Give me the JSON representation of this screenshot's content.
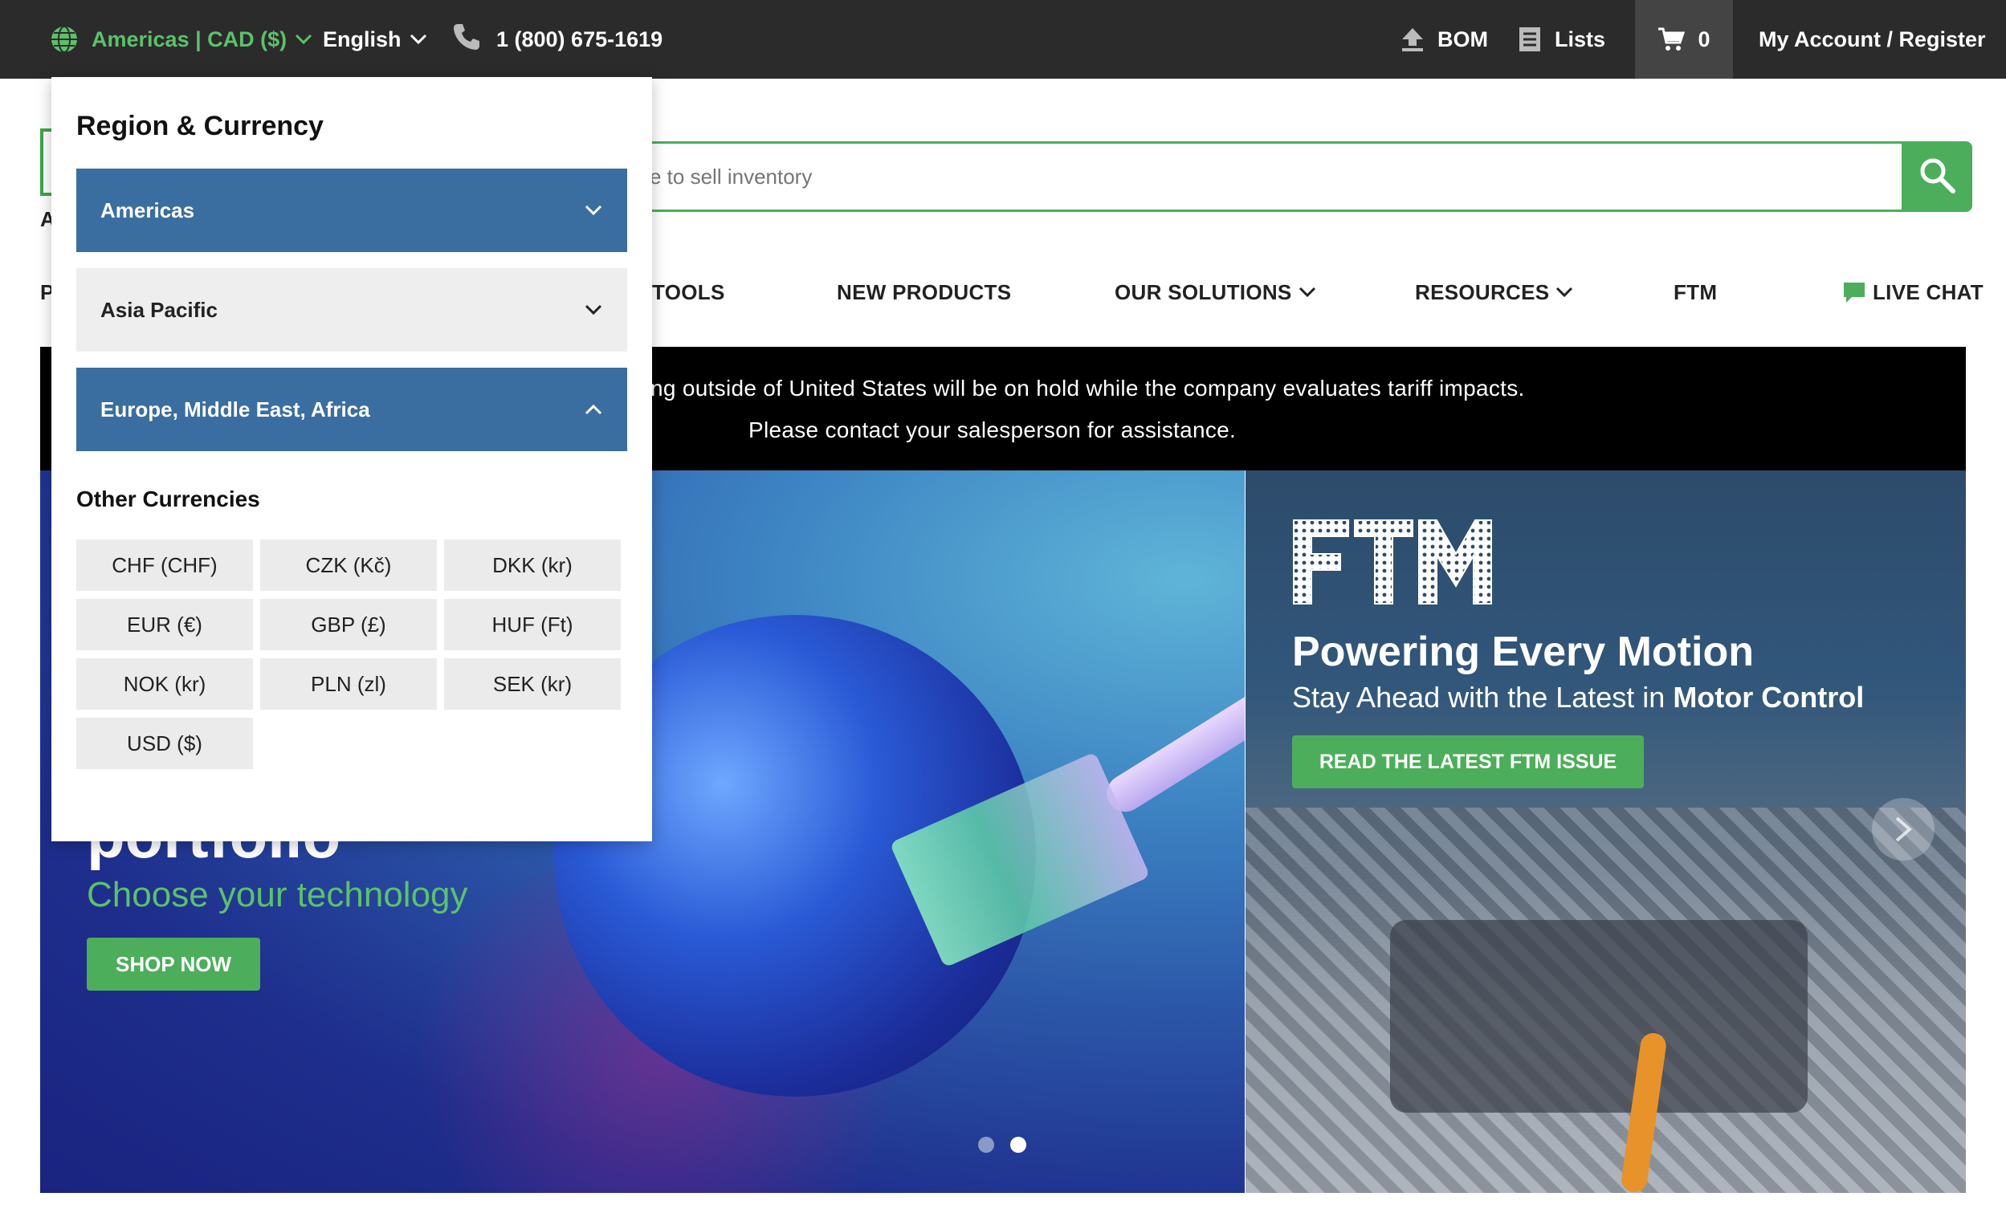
{
  "topbar": {
    "region_label": "Americas | CAD ($)",
    "language_label": "English",
    "phone_label": "1 (800) 675-1619",
    "bom_label": "BOM",
    "lists_label": "Lists",
    "cart_count": "0",
    "account_label": "My Account / Register"
  },
  "search": {
    "placeholder": "e to sell inventory"
  },
  "nav": {
    "partial_left": "P",
    "tools": "TOOLS",
    "new_products": "NEW PRODUCTS",
    "our_solutions": "OUR SOLUTIONS",
    "resources": "RESOURCES",
    "ftm": "FTM",
    "live_chat": "LIVE CHAT"
  },
  "logo_fragment_letter": "A",
  "notice": {
    "line1": "ng outside of United States will be on hold while the company evaluates tariff impacts.",
    "line2": "Please contact your salesperson for assistance."
  },
  "banner_left": {
    "title": "portfolio",
    "subtitle": "Choose your technology",
    "button": "SHOP NOW"
  },
  "banner_right": {
    "logo_text": "FTM",
    "title": "Powering Every Motion",
    "subtitle_prefix": "Stay Ahead with the Latest in ",
    "subtitle_bold": "Motor Control",
    "button": "READ THE LATEST FTM ISSUE"
  },
  "dropdown": {
    "title": "Region & Currency",
    "regions": [
      {
        "label": "Americas",
        "state": "collapsed"
      },
      {
        "label": "Asia Pacific",
        "state": "collapsed"
      },
      {
        "label": "Europe, Middle East, Africa",
        "state": "expanded"
      }
    ],
    "other_currencies_title": "Other Currencies",
    "currencies": [
      "CHF (CHF)",
      "CZK (Kč)",
      "DKK (kr)",
      "EUR (€)",
      "GBP (£)",
      "HUF (Ft)",
      "NOK (kr)",
      "PLN (zl)",
      "SEK (kr)",
      "USD ($)"
    ]
  },
  "colors": {
    "topbar_bg": "#2b2b2b",
    "brand_green": "#4cae5a",
    "region_green": "#5cc16a",
    "accordion_blue": "#3b6ea0",
    "accordion_grey": "#eeeeee"
  },
  "icons": {
    "region": "globe-icon",
    "phone": "phone-icon",
    "bom": "upload-icon",
    "lists": "list-icon",
    "cart": "cart-icon",
    "search": "search-icon",
    "chat": "chat-bubble-icon"
  }
}
